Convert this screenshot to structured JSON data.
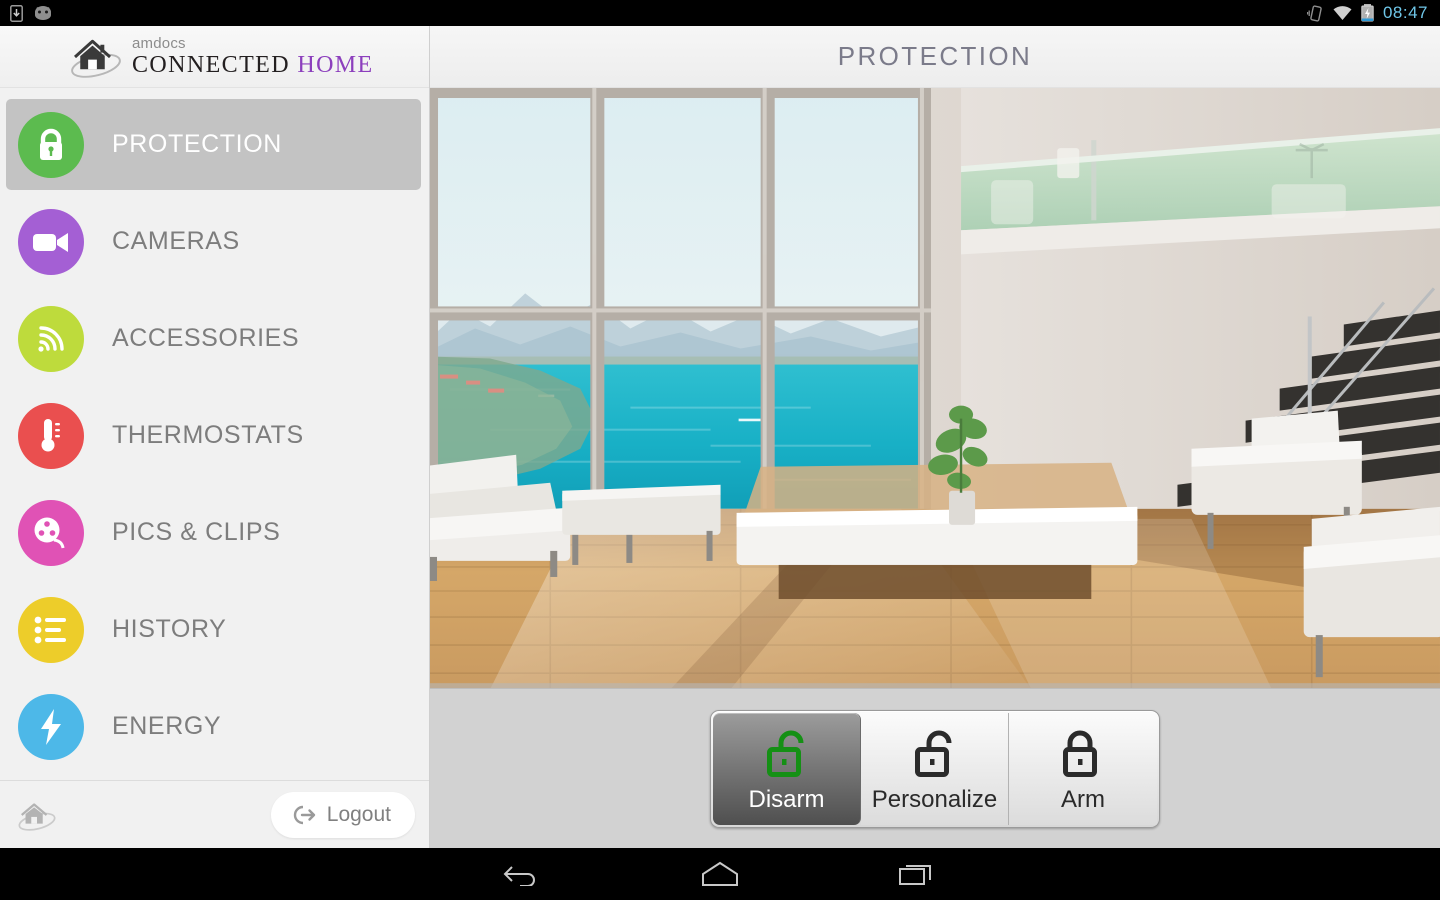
{
  "statusbar": {
    "left_icons": [
      "download-icon",
      "android-debug-icon"
    ],
    "right_icons": [
      "vibrate-icon",
      "wifi-icon",
      "battery-charging-icon"
    ],
    "clock": "08:47",
    "clock_color": "#6fc6e8"
  },
  "brand": {
    "logo_icon": "house-swoosh-logo",
    "sub": "amdocs",
    "name_1": "CONNECTED",
    "name_2": "HOME",
    "home_color": "#8c3fbd"
  },
  "sidebar": {
    "items": [
      {
        "label": "PROTECTION",
        "icon": "lock-closed-icon",
        "color": "#5cbb4f",
        "active": true
      },
      {
        "label": "CAMERAS",
        "icon": "video-camera-icon",
        "color": "#a45fd4",
        "active": false
      },
      {
        "label": "ACCESSORIES",
        "icon": "wifi-signal-icon",
        "color": "#bedb3c",
        "active": false
      },
      {
        "label": "THERMOSTATS",
        "icon": "thermometer-icon",
        "color": "#ea4f4f",
        "active": false
      },
      {
        "label": "PICS & CLIPS",
        "icon": "film-reel-icon",
        "color": "#e052b5",
        "active": false
      },
      {
        "label": "HISTORY",
        "icon": "list-icon",
        "color": "#edcd2a",
        "active": false
      },
      {
        "label": "ENERGY",
        "icon": "lightning-bolt-icon",
        "color": "#4db8e8",
        "active": false
      }
    ],
    "active_bg": "#c3c3c3",
    "footer": {
      "home_icon": "house-swoosh-icon",
      "logout_label": "Logout",
      "logout_icon": "logout-arrow-icon"
    }
  },
  "header": {
    "title": "PROTECTION"
  },
  "photo": {
    "alt": "modern-living-room-sea-view",
    "sky_color": "#dceef3",
    "sea_color": "#22b6c9",
    "floor_color": "#c49a63",
    "wall_color": "#ded7d0",
    "glass_rail_color": "#b8d9bf"
  },
  "controls": {
    "buttons": [
      {
        "label": "Disarm",
        "icon": "lock-open-green-icon",
        "selected": true
      },
      {
        "label": "Personalize",
        "icon": "lock-open-icon",
        "selected": false
      },
      {
        "label": "Arm",
        "icon": "lock-closed-icon",
        "selected": false
      }
    ],
    "selected_color": "#ffffff",
    "disarm_icon_color": "#159015"
  },
  "navbar": {
    "buttons": [
      {
        "name": "back-button",
        "icon": "back-arrow-icon"
      },
      {
        "name": "home-button",
        "icon": "home-icon"
      },
      {
        "name": "recents-button",
        "icon": "recents-icon"
      }
    ]
  }
}
